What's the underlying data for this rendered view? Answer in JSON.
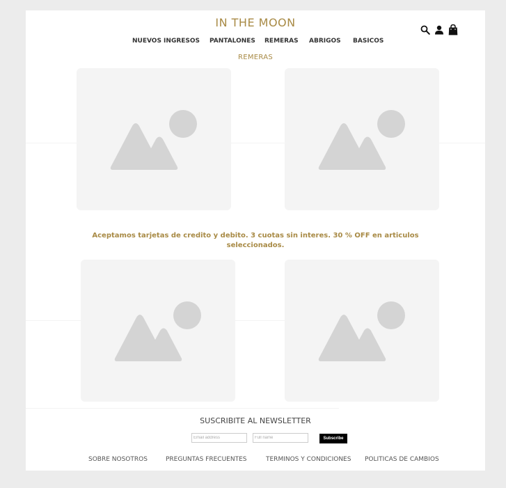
{
  "brand": {
    "name": "IN THE MOON",
    "color": "#a88a45"
  },
  "header_icons": [
    "search-icon",
    "user-icon",
    "shopping-bag-icon"
  ],
  "nav": {
    "items": [
      {
        "label": "NUEVOS INGRESOS"
      },
      {
        "label": "PANTALONES"
      },
      {
        "label": "REMERAS"
      },
      {
        "label": "ABRIGOS"
      },
      {
        "label": "BASICOS"
      }
    ],
    "active_sub": "REMERAS"
  },
  "promo": {
    "text": "Aceptamos tarjetas de credito y debito. 3 cuotas sin interes. 30 % OFF en articulos seleccionados."
  },
  "products": {
    "image_icon": "image-placeholder-icon",
    "count": 4
  },
  "newsletter": {
    "title": "SUSCRIBITE AL NEWSLETTER",
    "email_placeholder": "Email address",
    "name_placeholder": "Full name",
    "button_label": "Subscribe"
  },
  "footer": {
    "links": [
      {
        "label": "SOBRE NOSOTROS"
      },
      {
        "label": "PREGUNTAS FRECUENTES"
      },
      {
        "label": "TERMINOS Y CONDICIONES"
      },
      {
        "label": "POLITICAS DE CAMBIOS"
      }
    ]
  },
  "colors": {
    "background": "#ececec",
    "page": "#ffffff",
    "accent": "#a88a45",
    "placeholder_bg": "#f4f4f4",
    "placeholder_shape": "#d4d4d4"
  }
}
